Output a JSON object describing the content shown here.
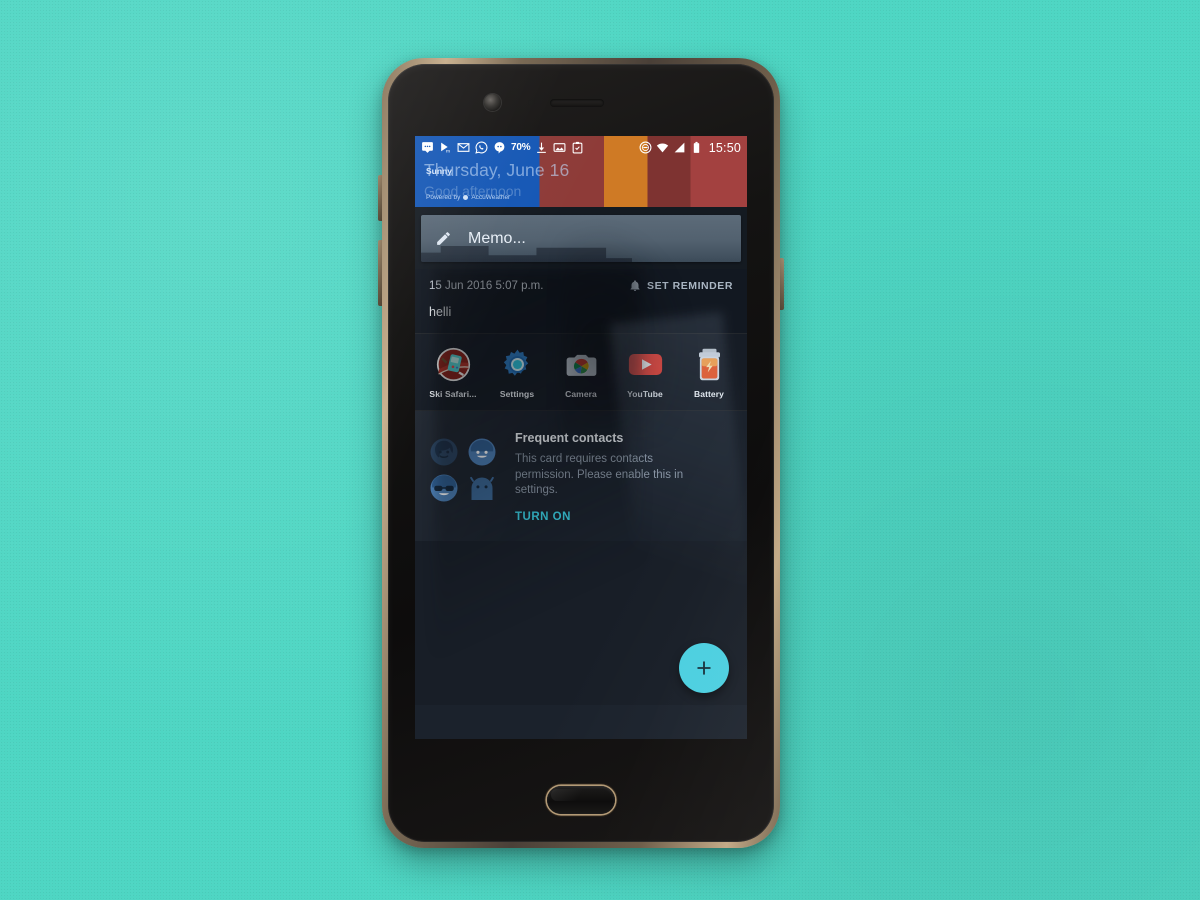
{
  "scene": {
    "background_color": "#4ed6c3",
    "device_name": "oneplus-3-smartphone"
  },
  "statusbar": {
    "battery_percent": "70%",
    "clock": "15:50",
    "left_icons": [
      {
        "name": "messages-icon"
      },
      {
        "name": "video-play-icon"
      },
      {
        "name": "gmail-icon"
      },
      {
        "name": "whatsapp-icon"
      },
      {
        "name": "hangouts-icon"
      }
    ],
    "right_of_percent_icons": [
      {
        "name": "download-icon"
      },
      {
        "name": "screenshot-image-icon"
      },
      {
        "name": "clipboard-task-icon"
      }
    ],
    "right_icons": [
      {
        "name": "do-not-disturb-icon"
      },
      {
        "name": "wifi-icon"
      },
      {
        "name": "cell-signal-icon"
      },
      {
        "name": "battery-icon"
      }
    ]
  },
  "weather_widget": {
    "condition": "Sunny",
    "powered_by": "Powered by",
    "provider": "AccuWeather"
  },
  "greeting": {
    "date_line": "Thursday, June 16",
    "salutation": "Good afternoon"
  },
  "memo_card": {
    "placeholder": "Memo...",
    "icon": "pencil-icon"
  },
  "note_card": {
    "timestamp": "15 Jun 2016 5:07 p.m.",
    "reminder_label": "SET REMINDER",
    "reminder_icon": "bell-icon",
    "body": "helli"
  },
  "apps": {
    "items": [
      {
        "label": "Ski Safari...",
        "icon": "ski-safari-icon"
      },
      {
        "label": "Settings",
        "icon": "settings-gear-icon"
      },
      {
        "label": "Camera",
        "icon": "camera-icon"
      },
      {
        "label": "YouTube",
        "icon": "youtube-icon"
      },
      {
        "label": "Battery",
        "icon": "battery-app-icon"
      }
    ]
  },
  "frequent_contacts": {
    "title": "Frequent contacts",
    "description": "This card requires contacts permission. Please enable this in settings.",
    "cta_label": "TURN ON",
    "cta_color": "#38c6d9",
    "avatars": [
      {
        "name": "avatar-person-icon"
      },
      {
        "name": "avatar-smiley-icon"
      },
      {
        "name": "avatar-sunglasses-icon"
      },
      {
        "name": "avatar-android-icon"
      }
    ]
  },
  "fab": {
    "icon": "plus-icon",
    "color": "#4bcfe0"
  }
}
